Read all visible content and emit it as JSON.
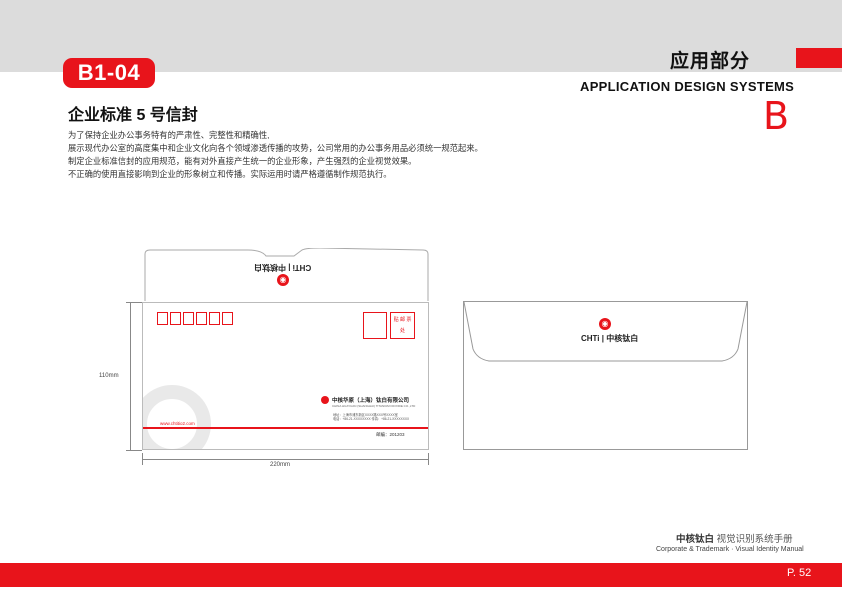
{
  "header": {
    "code": "B1-04",
    "section_cn": "应用部分",
    "section_en": "APPLICATION DESIGN SYSTEMS",
    "section_letter": "B",
    "accent_color": "#e8141b"
  },
  "page": {
    "title": "企业标准 5 号信封",
    "description": [
      "为了保持企业办公事务特有的严肃性、完整性和精确性,",
      "展示现代办公室的高度集中和企业文化向各个领域渗透传播的攻势，公司常用的办公事务用品必须统一规范起来。",
      "制定企业标准信封的应用规范，能有对外直接产生统一的企业形象，产生强烈的企业视觉效果。",
      "不正确的使用直接影响到企业的形象树立和传播。实际运用时请严格遵循制作规范执行。"
    ]
  },
  "envelope_front": {
    "flap_logo": "CHTi | 中核钛白",
    "stamp_label": "贴 邮 票 处",
    "url": "www.chtitio2.com",
    "company_name": "中核华原（上海）钛白有限公司",
    "company_sub": "CHINA HUAYUAN (SHANGHAI) TITANIUM DIOXIDE CO.,LTD",
    "address": "地址：上海市浦东新区XXXX路XXX号XXXX室",
    "contacts": "电话：+86-21-XXXXXXXX     传真：+86-21-XXXXXXXX",
    "postcode": "邮编：201203",
    "height_label": "110mm",
    "width_label": "220mm"
  },
  "envelope_back": {
    "logo_text": "CHTi | 中核钛白"
  },
  "footer": {
    "brand_cn": "中核钛白",
    "manual_cn": "视觉识别系统手册",
    "manual_en": "Corporate & Trademark · Visual Identity Manual",
    "page_number": "P. 52"
  }
}
